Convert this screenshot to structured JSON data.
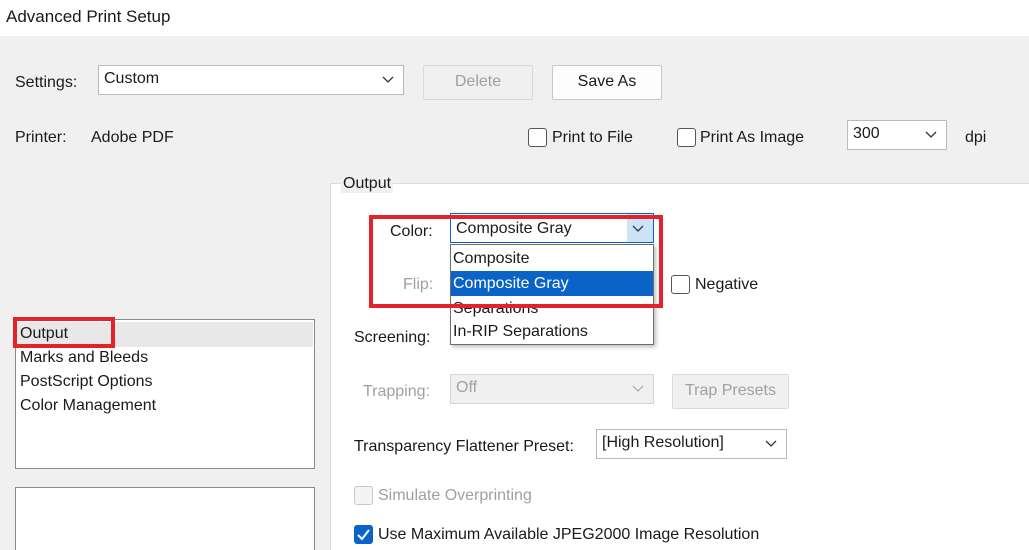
{
  "window": {
    "title": "Advanced Print Setup"
  },
  "settings": {
    "label": "Settings:",
    "value": "Custom",
    "delete_label": "Delete",
    "save_as_label": "Save As"
  },
  "printer": {
    "label": "Printer:",
    "value": "Adobe PDF",
    "print_to_file_label": "Print to File",
    "print_as_image_label": "Print As Image",
    "dpi_value": "300",
    "dpi_label": "dpi"
  },
  "sidebar": {
    "items": [
      {
        "label": "Output"
      },
      {
        "label": "Marks and Bleeds"
      },
      {
        "label": "PostScript Options"
      },
      {
        "label": "Color Management"
      }
    ]
  },
  "output": {
    "section_label": "Output",
    "color_label": "Color:",
    "color_value": "Composite Gray",
    "color_options": [
      "Composite",
      "Composite Gray",
      "Separations",
      "In-RIP Separations"
    ],
    "flip_label": "Flip:",
    "negative_label": "Negative",
    "screening_label": "Screening:",
    "trapping_label": "Trapping:",
    "trapping_value": "Off",
    "trap_presets_label": "Trap Presets",
    "flattener_label": "Transparency Flattener Preset:",
    "flattener_value": "[High Resolution]",
    "simulate_overprinting_label": "Simulate Overprinting",
    "jpeg2000_label": "Use Maximum Available JPEG2000 Image Resolution"
  },
  "colors": {
    "highlight": "#e3232b",
    "selection": "#0a64c8"
  }
}
